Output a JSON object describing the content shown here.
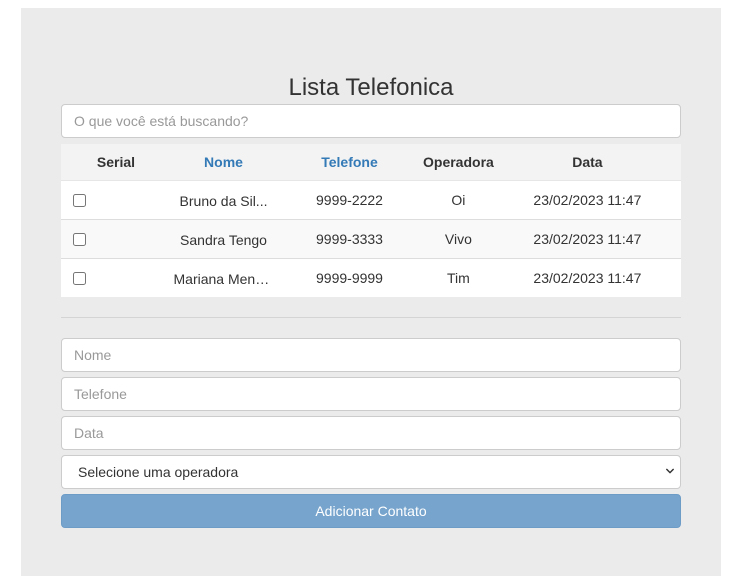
{
  "page": {
    "title": "Lista Telefonica"
  },
  "search": {
    "placeholder": "O que você está buscando?"
  },
  "table": {
    "headers": {
      "serial": "Serial",
      "nome": "Nome",
      "telefone": "Telefone",
      "operadora": "Operadora",
      "data": "Data"
    },
    "rows": [
      {
        "nome": "Bruno da Sil...",
        "telefone": "9999-2222",
        "operadora": "Oi",
        "data": "23/02/2023 11:47"
      },
      {
        "nome": "Sandra Tengo",
        "telefone": "9999-3333",
        "operadora": "Vivo",
        "data": "23/02/2023 11:47"
      },
      {
        "nome": "Mariana Mend...",
        "telefone": "9999-9999",
        "operadora": "Tim",
        "data": "23/02/2023 11:47"
      }
    ]
  },
  "form": {
    "nome_placeholder": "Nome",
    "telefone_placeholder": "Telefone",
    "data_placeholder": "Data",
    "operadora_selected": "Selecione uma operadora",
    "submit_label": "Adicionar Contato"
  },
  "colors": {
    "link": "#337ab7",
    "button": "#76a4cc",
    "panel": "#ebebeb"
  },
  "icons": {
    "select_arrow": "chevron-down-icon"
  }
}
